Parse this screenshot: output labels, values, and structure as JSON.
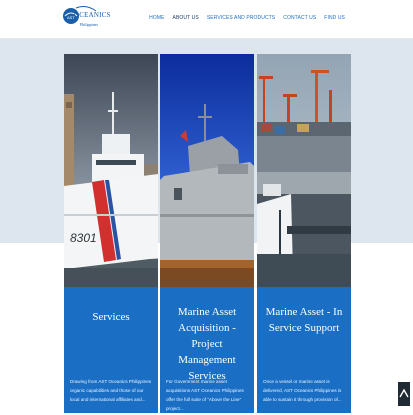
{
  "brand": {
    "wordmark": "OCEANICS",
    "logo_ast": "AST",
    "sub": "Philippines"
  },
  "nav": {
    "items": [
      {
        "label": "HOME"
      },
      {
        "label": "ABOUT US"
      },
      {
        "label": "SERVICES AND PRODUCTS"
      },
      {
        "label": "CONTACT US"
      },
      {
        "label": "FIND US"
      }
    ],
    "active_index": 1
  },
  "cards": [
    {
      "title": "Services",
      "text": "Drawing from AST Oceanics Philippines organic capabilities and those of our local and international affiliates and...",
      "hull_number": "8301"
    },
    {
      "title": "Marine Asset Acquisition - Project Management Services",
      "text": "For Government marine asset acquisitions AST Oceanics Philippines offer the full suite of \"Above the Line\" project..."
    },
    {
      "title": "Marine Asset - In Service Support",
      "text": "Once a vessel or marine asset is delivered, AST Oceanics Philippines is able to sustain it through provision of..."
    }
  ],
  "scroll_top_icon": "chevron-up-icon",
  "colors": {
    "accent": "#1a6fc4",
    "nav_link": "#1d6fc6",
    "band": "#dde6ee"
  }
}
